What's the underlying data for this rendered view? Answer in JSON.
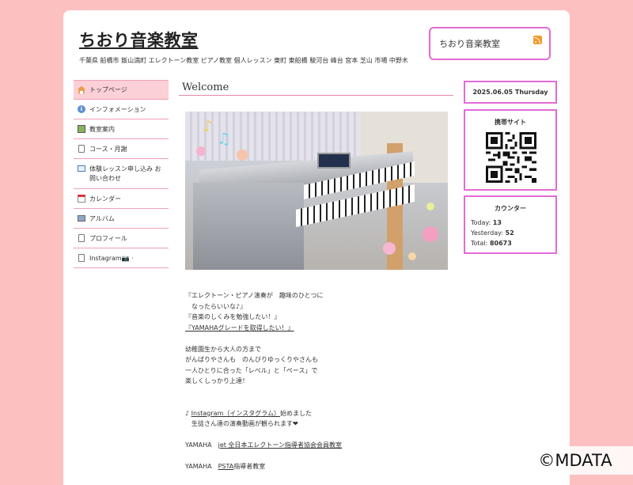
{
  "site": {
    "title": "ちおり音楽教室",
    "tagline": "千葉県 船橋市 飯山満町 エレクトーン教室 ピアノ教室 個人レッスン 東町 東船橋 駿河台 峰台 宮本 芝山 市場 中野木"
  },
  "header_box": {
    "label": "ちおり音楽教室",
    "icon": "rss-icon"
  },
  "nav": {
    "items": [
      {
        "label": "トップページ",
        "icon": "home-icon"
      },
      {
        "label": "インフォメーション",
        "icon": "info-icon"
      },
      {
        "label": "教室案内",
        "icon": "map-icon"
      },
      {
        "label": "コース・月謝",
        "icon": "page-icon"
      },
      {
        "label": "体験レッスン申し込み お問い合わせ",
        "icon": "mail-icon"
      },
      {
        "label": "カレンダー",
        "icon": "calendar-icon"
      },
      {
        "label": "アルバム",
        "icon": "album-icon"
      },
      {
        "label": "プロフィール",
        "icon": "page-icon"
      },
      {
        "label": "Instagram📷 ·",
        "icon": "page-icon"
      }
    ]
  },
  "main": {
    "heading": "Welcome",
    "lines": [
      "『エレクトーン・ピアノ演奏が　趣味のひとつに",
      "　なったらいいな♪』",
      "『音楽のしくみを勉強したい！』",
      "『YAMAHAグレードを取得したい！』",
      "幼稚園生から大人の方まで",
      "がんばりやさんも　のんびりゆっくりやさんも",
      "一人ひとりに合った「レベル」と「ペース」で",
      "楽しくしっかり上達！",
      "♪ ",
      "Instagram（インスタグラム）",
      "始めました",
      "　生徒さん達の演奏動画が観られます❤",
      "YAMAHA　",
      "jet 全日本エレクトーン指導者協会会員教室",
      "YAMAHA　",
      "PSTA",
      "指導者教室"
    ]
  },
  "sidebar": {
    "date": "2025.06.05 Thursday",
    "mobile_title": "携帯サイト",
    "counter": {
      "title": "カウンター",
      "today_label": "Today:",
      "today_value": "13",
      "yesterday_label": "Yesterday:",
      "yesterday_value": "52",
      "total_label": "Total:",
      "total_value": "80673"
    }
  },
  "watermark": "©MDATA",
  "colors": {
    "background": "#fcc0c0",
    "accent": "#e26bd6",
    "nav_border": "#f0a0bd"
  }
}
